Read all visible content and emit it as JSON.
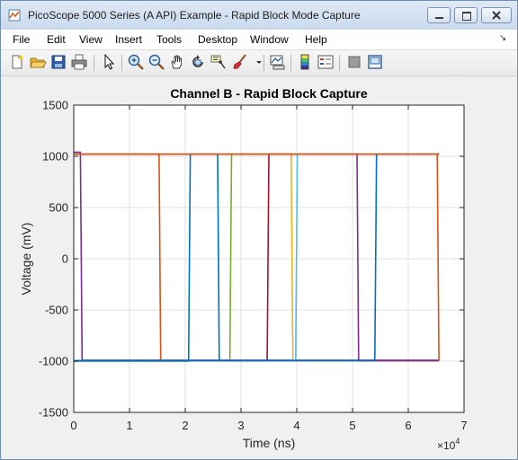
{
  "window": {
    "title": "PicoScope 5000 Series (A API) Example - Rapid Block Mode Capture"
  },
  "menu": [
    "File",
    "Edit",
    "View",
    "Insert",
    "Tools",
    "Desktop",
    "Window",
    "Help"
  ],
  "toolbar": [
    "new-figure-icon",
    "open-file-icon",
    "save-icon",
    "print-icon",
    "pointer-icon",
    "zoom-in-icon",
    "zoom-out-icon",
    "pan-icon",
    "rotate-icon",
    "data-cursor-icon",
    "brush-icon",
    "brush-dropdown-icon",
    "link-plot-icon",
    "colorbar-icon",
    "legend-icon",
    "hide-plot-tools-icon",
    "show-plot-tools-icon"
  ],
  "chart_data": {
    "type": "line",
    "title": "Channel B - Rapid Block Capture",
    "xlabel": "Time (ns)",
    "ylabel": "Voltage (mV)",
    "x_multiplier_label": "×10",
    "x_multiplier_exponent": "4",
    "xlim": [
      0,
      70000
    ],
    "ylim": [
      -1500,
      1500
    ],
    "xticks": [
      "0",
      "1",
      "2",
      "3",
      "4",
      "5",
      "6",
      "7"
    ],
    "yticks": [
      "1500",
      "1000",
      "500",
      "0",
      "-500",
      "-1000",
      "-1500"
    ],
    "grid": true,
    "legend": "none",
    "series": [
      {
        "color": "#7e2f8e",
        "x": [
          0,
          1200,
          1500,
          65500
        ],
        "y": [
          1040,
          1040,
          -990,
          -990
        ]
      },
      {
        "color": "#d95319",
        "x": [
          0,
          15300,
          15600,
          65500
        ],
        "y": [
          1020,
          1020,
          -995,
          -995
        ]
      },
      {
        "color": "#0072bd",
        "x": [
          0,
          20600,
          20900,
          65500
        ],
        "y": [
          -1000,
          -1000,
          1020,
          1020
        ]
      },
      {
        "color": "#0072bd",
        "x": [
          0,
          25800,
          26100,
          65500
        ],
        "y": [
          1020,
          1020,
          -995,
          -995
        ]
      },
      {
        "color": "#77ac30",
        "x": [
          0,
          28000,
          28300,
          65500
        ],
        "y": [
          -995,
          -995,
          1020,
          1020
        ]
      },
      {
        "color": "#a2142f",
        "x": [
          0,
          34700,
          35000,
          65500
        ],
        "y": [
          -995,
          -995,
          1020,
          1020
        ]
      },
      {
        "color": "#edb120",
        "x": [
          0,
          39000,
          39300,
          65500
        ],
        "y": [
          1020,
          1020,
          -995,
          -995
        ]
      },
      {
        "color": "#4dbeee",
        "x": [
          0,
          39800,
          40100,
          65500
        ],
        "y": [
          -995,
          -995,
          1020,
          1020
        ]
      },
      {
        "color": "#7e2f8e",
        "x": [
          0,
          50800,
          51100,
          65500
        ],
        "y": [
          1020,
          1020,
          -995,
          -995
        ]
      },
      {
        "color": "#0072bd",
        "x": [
          0,
          54000,
          54300,
          65500
        ],
        "y": [
          -995,
          -995,
          1020,
          1020
        ]
      },
      {
        "color": "#d95319",
        "x": [
          0,
          65200,
          65500
        ],
        "y": [
          1020,
          1020,
          -995
        ]
      }
    ]
  }
}
